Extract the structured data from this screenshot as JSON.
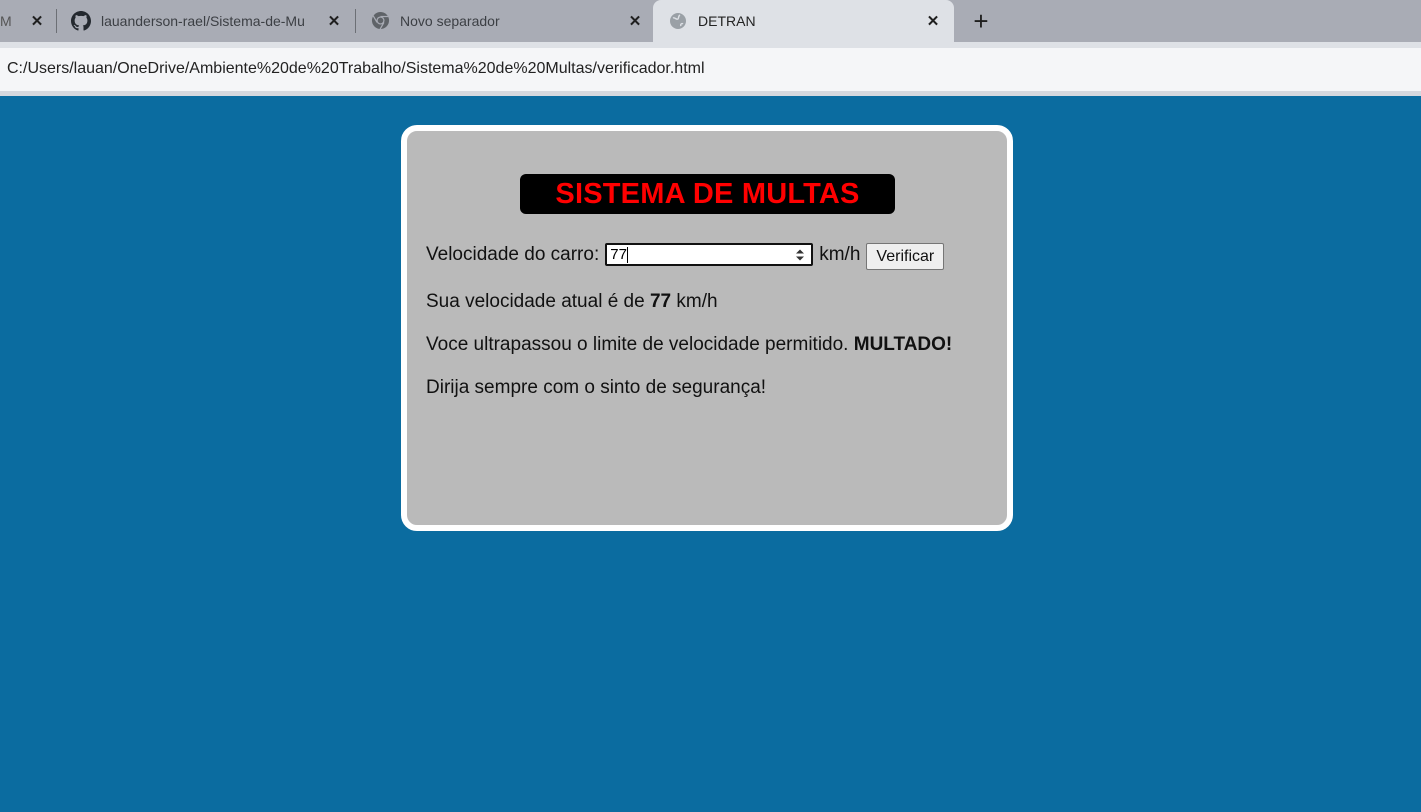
{
  "browser": {
    "tabs": [
      {
        "title": "M",
        "favicon": "page-icon"
      },
      {
        "title": "lauanderson-rael/Sistema-de-Mu",
        "favicon": "github-icon"
      },
      {
        "title": "Novo separador",
        "favicon": "chrome-icon"
      },
      {
        "title": "DETRAN",
        "favicon": "globe-icon",
        "active": true
      }
    ],
    "new_tab_symbol": "+",
    "close_symbol": "✕",
    "url": "C:/Users/lauan/OneDrive/Ambiente%20de%20Trabalho/Sistema%20de%20Multas/verificador.html"
  },
  "page": {
    "background_color": "#0b6ca0",
    "card_color": "#bababa",
    "heading": "SISTEMA DE MULTAS",
    "heading_color": "#ff0000",
    "speed_label": "Velocidade do carro:",
    "speed_value": "77",
    "unit": "km/h",
    "verify_button": "Verificar",
    "result": {
      "prefix": "Sua velocidade atual é de",
      "value": "77",
      "unit": "km/h"
    },
    "warning": {
      "text": "Voce ultrapassou o limite de velocidade permitido.",
      "emphasis": "MULTADO!"
    },
    "advice": "Dirija sempre com o sinto de segurança!"
  }
}
